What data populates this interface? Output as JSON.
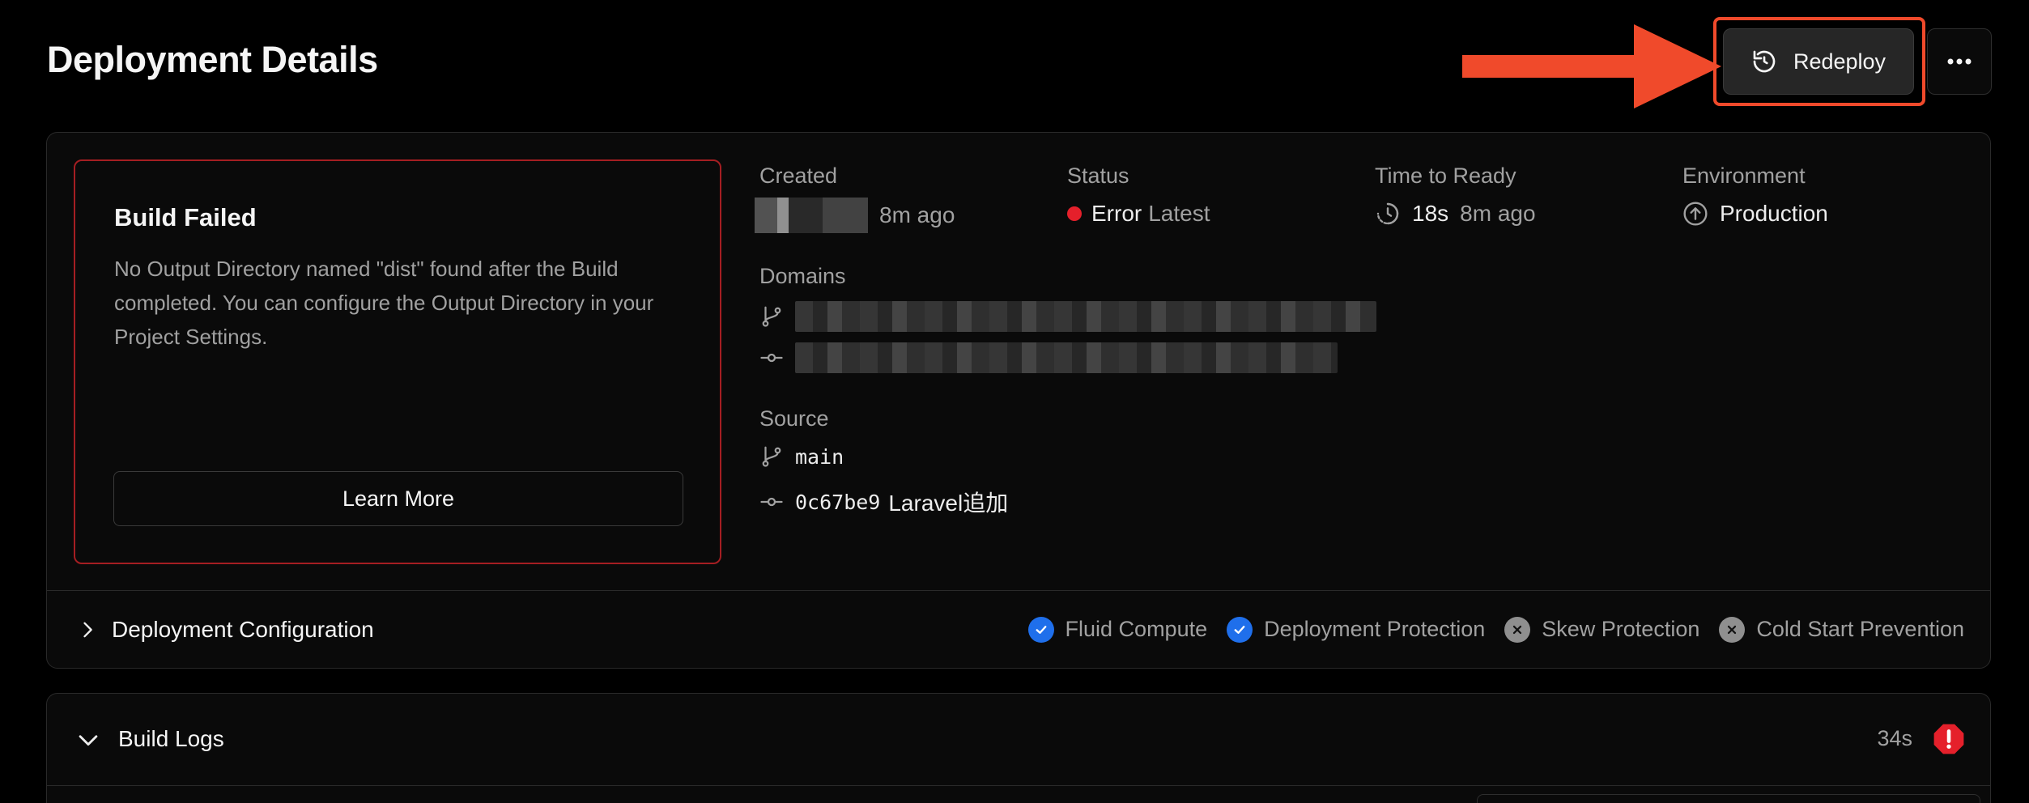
{
  "page": {
    "title": "Deployment Details"
  },
  "actions": {
    "redeploy_label": "Redeploy"
  },
  "build_status": {
    "title": "Build Failed",
    "description": "No Output Directory named \"dist\" found after the Build completed. You can configure the Output Directory in your Project Settings.",
    "learn_more_label": "Learn More"
  },
  "meta": {
    "created": {
      "label": "Created",
      "time": "8m ago"
    },
    "status": {
      "label": "Status",
      "value": "Error",
      "tag": "Latest",
      "color": "#e5202b"
    },
    "time_to_ready": {
      "label": "Time to Ready",
      "duration": "18s",
      "time": "8m ago"
    },
    "environment": {
      "label": "Environment",
      "value": "Production"
    },
    "domains": {
      "label": "Domains"
    },
    "source": {
      "label": "Source",
      "branch": "main",
      "commit_hash": "0c67be9",
      "commit_message": "Laravel追加"
    }
  },
  "config": {
    "title": "Deployment Configuration",
    "features": [
      {
        "label": "Fluid Compute",
        "enabled": true
      },
      {
        "label": "Deployment Protection",
        "enabled": true
      },
      {
        "label": "Skew Protection",
        "enabled": false
      },
      {
        "label": "Cold Start Prevention",
        "enabled": false
      }
    ]
  },
  "build_logs": {
    "title": "Build Logs",
    "duration": "34s"
  },
  "colors": {
    "accent_blue": "#1f6feb",
    "error_red": "#e5202b",
    "highlight_orange": "#f04a2b",
    "disabled_gray": "#8f8f8f"
  }
}
